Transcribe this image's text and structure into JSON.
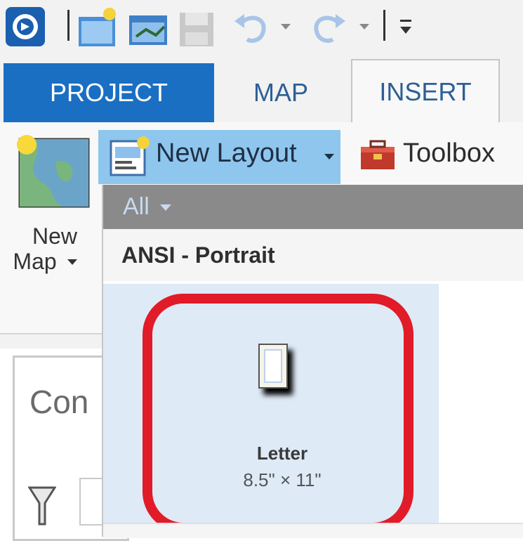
{
  "ribbon_tabs": [
    {
      "label": "PROJECT"
    },
    {
      "label": "MAP"
    },
    {
      "label": "INSERT"
    }
  ],
  "insert_group": {
    "new_map_label_line1": "New",
    "new_map_label_line2": "Map",
    "new_layout_label": "New Layout",
    "toolbox_label": "Toolbox"
  },
  "layout_gallery": {
    "filter_label": "All",
    "section_header": "ANSI - Portrait",
    "items": [
      {
        "name": "Letter",
        "size": "8.5\" × 11\""
      }
    ]
  },
  "contents_pane": {
    "title": "Con"
  },
  "colors": {
    "project_tab": "#1a6fc2",
    "selected_button": "#8ec6ee",
    "gallery_item_bg": "#deeaf6",
    "highlight": "#e11b28"
  }
}
